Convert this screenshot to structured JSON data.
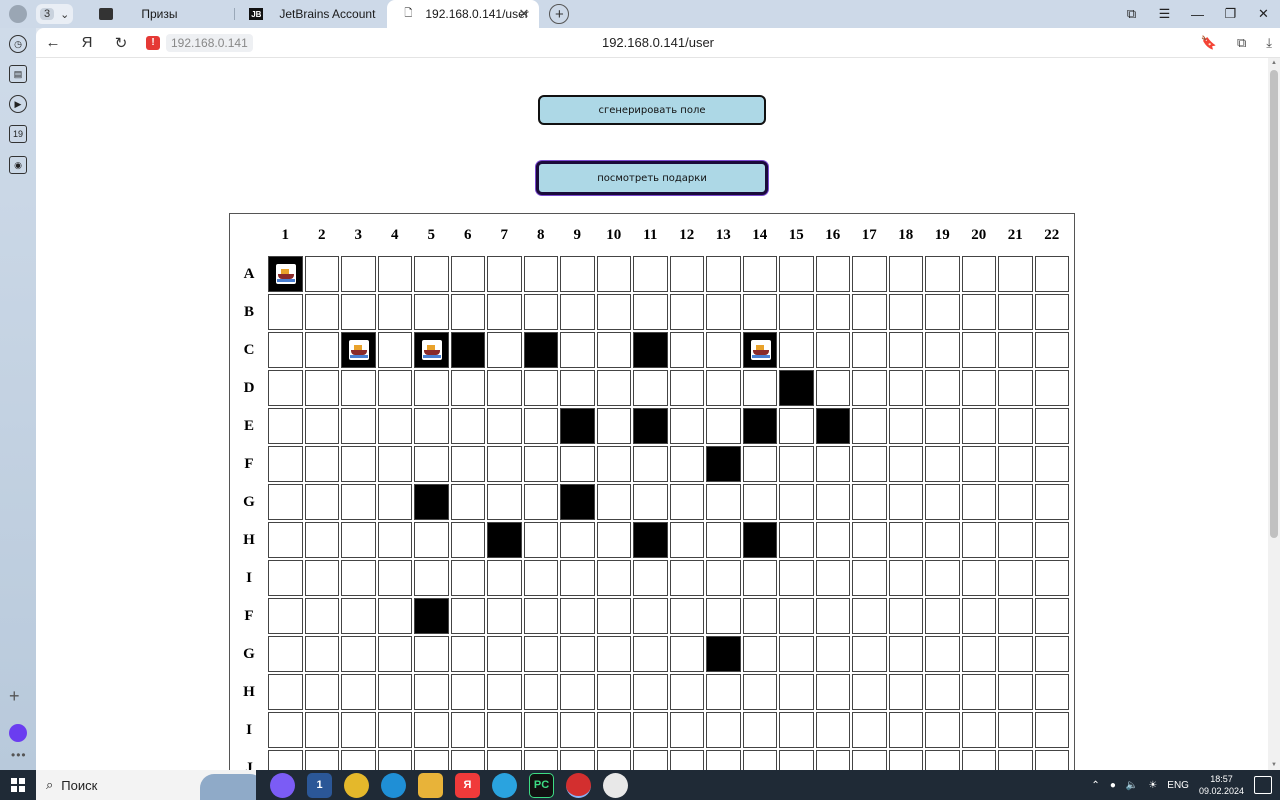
{
  "browser": {
    "tab_count": "3",
    "tabs": [
      {
        "label": "Призы"
      },
      {
        "label": "JetBrains Account",
        "icon_text": "JB"
      },
      {
        "label": "192.168.0.141/user"
      }
    ],
    "address_pill": "192.168.0.141",
    "page_title": "192.168.0.141/user"
  },
  "page": {
    "generate_button": "сгенерировать поле",
    "gifts_button": "посмотреть подарки"
  },
  "board": {
    "columns": [
      "1",
      "2",
      "3",
      "4",
      "5",
      "6",
      "7",
      "8",
      "9",
      "10",
      "11",
      "12",
      "13",
      "14",
      "15",
      "16",
      "17",
      "18",
      "19",
      "20",
      "21",
      "22"
    ],
    "rows": [
      "A",
      "B",
      "C",
      "D",
      "E",
      "F",
      "G",
      "H",
      "I",
      "F",
      "G",
      "H",
      "I",
      "J"
    ],
    "filled_cells": {
      "0": {
        "1": "ship"
      },
      "2": {
        "3": "ship",
        "5": "ship",
        "6": "black",
        "8": "black",
        "11": "black",
        "14": "ship"
      },
      "3": {
        "15": "black"
      },
      "4": {
        "9": "black",
        "11": "black",
        "14": "black",
        "16": "black"
      },
      "5": {
        "13": "black"
      },
      "6": {
        "5": "black",
        "9": "black"
      },
      "7": {
        "7": "black",
        "11": "black",
        "14": "black"
      },
      "9": {
        "5": "black"
      },
      "10": {
        "13": "black"
      }
    }
  },
  "sidebar": {
    "calendar_day": "19"
  },
  "taskbar": {
    "search_label": "Поиск",
    "mail_badge": "1",
    "pycharm_label": "PC",
    "lang": "ENG",
    "time": "18:57",
    "date": "09.02.2024"
  }
}
